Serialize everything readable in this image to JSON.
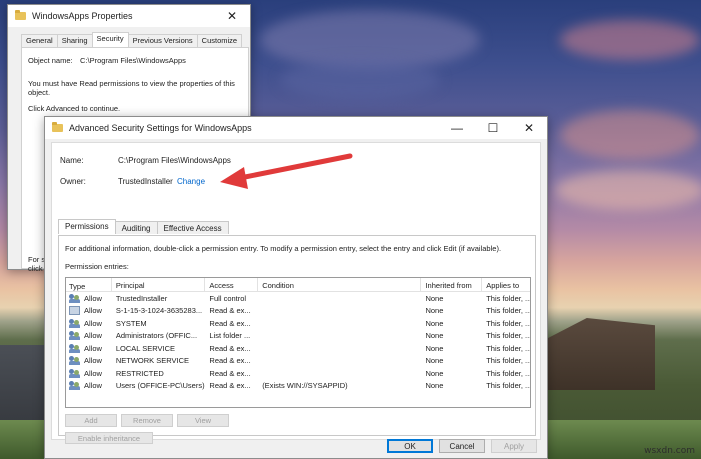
{
  "props_window": {
    "title": "WindowsApps Properties",
    "close": "✕",
    "tabs": [
      "General",
      "Sharing",
      "Security",
      "Previous Versions",
      "Customize"
    ],
    "active_tab": 2,
    "object_name_label": "Object name:",
    "object_name_value": "C:\\Program Files\\WindowsApps",
    "message_line1": "You must have Read permissions to view the properties of this",
    "message_line2": "object.",
    "advanced_hint": "Click Advanced to continue.",
    "left_fragment_1": "For sp",
    "left_fragment_2": "click"
  },
  "adv_window": {
    "title": "Advanced Security Settings for WindowsApps",
    "minimize": "—",
    "maximize": "☐",
    "close": "✕",
    "name_label": "Name:",
    "name_value": "C:\\Program Files\\WindowsApps",
    "owner_label": "Owner:",
    "owner_value": "TrustedInstaller",
    "change_link": "Change",
    "tabs": [
      "Permissions",
      "Auditing",
      "Effective Access"
    ],
    "active_tab": 0,
    "info_text": "For additional information, double-click a permission entry. To modify a permission entry, select the entry and click Edit (if available).",
    "entries_label": "Permission entries:",
    "columns": [
      "Type",
      "Principal",
      "Access",
      "Condition",
      "Inherited from",
      "Applies to"
    ],
    "rows": [
      {
        "icon": "user-group-icon",
        "type": "Allow",
        "principal": "TrustedInstaller",
        "access": "Full control",
        "condition": "",
        "inherited": "None",
        "applies": "This folder, ..."
      },
      {
        "icon": "sid-icon",
        "type": "Allow",
        "principal": "S-1-15-3-1024-3635283...",
        "access": "Read & ex...",
        "condition": "",
        "inherited": "None",
        "applies": "This folder, ..."
      },
      {
        "icon": "user-group-icon",
        "type": "Allow",
        "principal": "SYSTEM",
        "access": "Read & ex...",
        "condition": "",
        "inherited": "None",
        "applies": "This folder, ..."
      },
      {
        "icon": "user-group-icon",
        "type": "Allow",
        "principal": "Administrators (OFFIC...",
        "access": "List folder ...",
        "condition": "",
        "inherited": "None",
        "applies": "This folder, ..."
      },
      {
        "icon": "user-group-icon",
        "type": "Allow",
        "principal": "LOCAL SERVICE",
        "access": "Read & ex...",
        "condition": "",
        "inherited": "None",
        "applies": "This folder, ..."
      },
      {
        "icon": "user-group-icon",
        "type": "Allow",
        "principal": "NETWORK SERVICE",
        "access": "Read & ex...",
        "condition": "",
        "inherited": "None",
        "applies": "This folder, ..."
      },
      {
        "icon": "user-group-icon",
        "type": "Allow",
        "principal": "RESTRICTED",
        "access": "Read & ex...",
        "condition": "",
        "inherited": "None",
        "applies": "This folder, ..."
      },
      {
        "icon": "user-group-icon",
        "type": "Allow",
        "principal": "Users (OFFICE-PC\\Users)",
        "access": "Read & ex...",
        "condition": "(Exists WIN://SYSAPPID)",
        "inherited": "None",
        "applies": "This folder, ..."
      }
    ],
    "buttons": {
      "add": "Add",
      "remove": "Remove",
      "view": "View",
      "enable_inheritance": "Enable inheritance"
    },
    "dialog_buttons": {
      "ok": "OK",
      "cancel": "Cancel",
      "apply": "Apply"
    }
  },
  "annotation": {
    "arrow_color": "#e03a3a"
  },
  "watermark": "wsxdn.com"
}
